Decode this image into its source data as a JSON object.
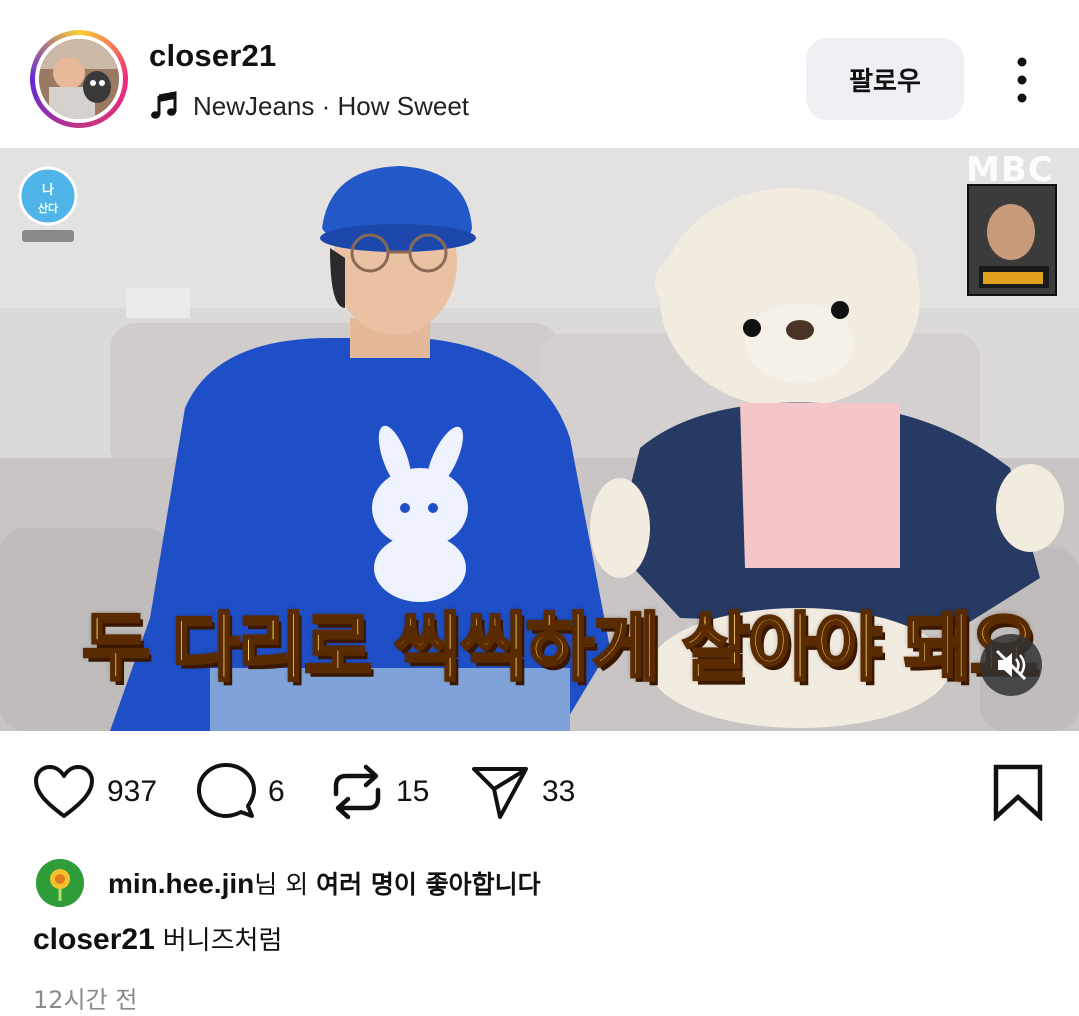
{
  "post": {
    "username": "closer21",
    "music_track": "NewJeans · How Sweet",
    "follow_label": "팔로우",
    "media": {
      "channel_logo": "MBC",
      "subtitle": "두 다리로 씩씩하게 살아야 돼요"
    },
    "actions": {
      "likes": "937",
      "comments": "6",
      "reposts": "15",
      "shares": "33"
    },
    "liked_by": {
      "user": "min.hee.jin",
      "suffix": "님 외 ",
      "rest": "여러 명이 좋아합니다"
    },
    "caption": {
      "user": "closer21",
      "text": "버니즈처럼"
    },
    "timestamp": "12시간 전"
  },
  "colors": {
    "follow_button_bg": "#eff0f3",
    "text": "#111111",
    "muted_text": "#8a8a8a",
    "avatar_ring": "instagram-gradient"
  },
  "icons": [
    "music-note-icon",
    "more-vertical-icon",
    "heart-icon",
    "comment-icon",
    "repost-icon",
    "send-icon",
    "bookmark-icon",
    "mute-icon"
  ]
}
